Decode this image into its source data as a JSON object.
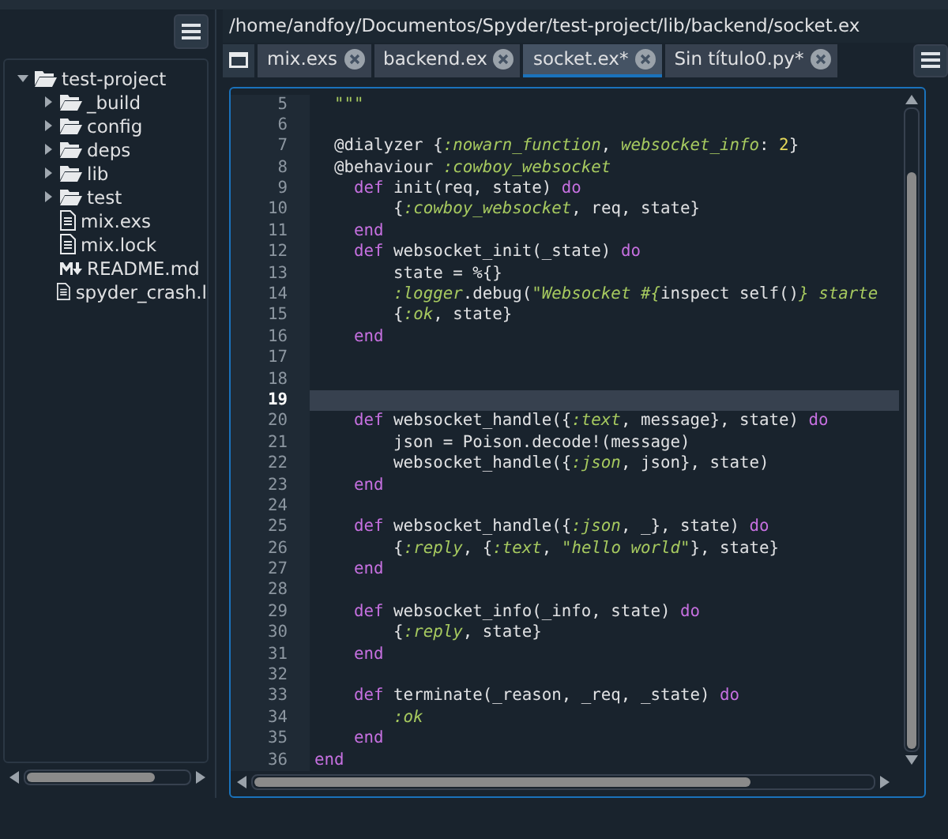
{
  "file_tree": {
    "items": [
      {
        "name": "test-project",
        "kind": "folder",
        "expanded": true,
        "children": [
          {
            "name": "_build",
            "kind": "folder",
            "expanded": false
          },
          {
            "name": "config",
            "kind": "folder",
            "expanded": false
          },
          {
            "name": "deps",
            "kind": "folder",
            "expanded": false
          },
          {
            "name": "lib",
            "kind": "folder",
            "expanded": false
          },
          {
            "name": "test",
            "kind": "folder",
            "expanded": false
          },
          {
            "name": "mix.exs",
            "kind": "file"
          },
          {
            "name": "mix.lock",
            "kind": "file"
          },
          {
            "name": "README.md",
            "kind": "markdown"
          },
          {
            "name": "spyder_crash.l",
            "kind": "file"
          }
        ]
      }
    ]
  },
  "editor": {
    "path": "/home/andfoy/Documentos/Spyder/test-project/lib/backend/socket.ex",
    "tabs": [
      {
        "label": "mix.exs",
        "selected": false
      },
      {
        "label": "backend.ex",
        "selected": false
      },
      {
        "label": "socket.ex*",
        "selected": true
      },
      {
        "label": "Sin título0.py*",
        "selected": false
      }
    ],
    "lines": [
      {
        "number": "5",
        "current": false,
        "tokens": [
          {
            "kind": "str",
            "text": "  \"\"\""
          }
        ]
      },
      {
        "number": "6",
        "current": false
      },
      {
        "number": "7",
        "current": false,
        "tokens": [
          {
            "kind": "plain",
            "text": "  @dialyzer {"
          },
          {
            "kind": "sym",
            "text": ":nowarn_function"
          },
          {
            "kind": "plain",
            "text": ", "
          },
          {
            "kind": "sym",
            "text": "websocket_info"
          },
          {
            "kind": "plain",
            "text": ": "
          },
          {
            "kind": "num",
            "text": "2"
          },
          {
            "kind": "plain",
            "text": "}"
          }
        ]
      },
      {
        "number": "8",
        "current": false,
        "tokens": [
          {
            "kind": "plain",
            "text": "  @behaviour "
          },
          {
            "kind": "sym",
            "text": ":cowboy_websocket"
          }
        ]
      },
      {
        "number": "9",
        "current": false,
        "tokens": [
          {
            "kind": "kw",
            "text": "    def"
          },
          {
            "kind": "plain",
            "text": " init(req, state) "
          },
          {
            "kind": "kw",
            "text": "do"
          }
        ]
      },
      {
        "number": "10",
        "current": false,
        "tokens": [
          {
            "kind": "plain",
            "text": "        {"
          },
          {
            "kind": "sym",
            "text": ":cowboy_websocket"
          },
          {
            "kind": "plain",
            "text": ", req, state}"
          }
        ]
      },
      {
        "number": "11",
        "current": false,
        "tokens": [
          {
            "kind": "kw",
            "text": "    end"
          }
        ]
      },
      {
        "number": "12",
        "current": false,
        "tokens": [
          {
            "kind": "kw",
            "text": "    def"
          },
          {
            "kind": "plain",
            "text": " websocket_init(_state) "
          },
          {
            "kind": "kw",
            "text": "do"
          }
        ]
      },
      {
        "number": "13",
        "current": false,
        "tokens": [
          {
            "kind": "plain",
            "text": "        state = %{}"
          }
        ]
      },
      {
        "number": "14",
        "current": false,
        "tokens": [
          {
            "kind": "sym",
            "text": "        :logger"
          },
          {
            "kind": "plain",
            "text": ".debug("
          },
          {
            "kind": "str",
            "text": "\"Websocket #{"
          },
          {
            "kind": "plain",
            "text": "inspect self()"
          },
          {
            "kind": "str",
            "text": "} starte"
          }
        ]
      },
      {
        "number": "15",
        "current": false,
        "tokens": [
          {
            "kind": "plain",
            "text": "        {"
          },
          {
            "kind": "sym",
            "text": ":ok"
          },
          {
            "kind": "plain",
            "text": ", state}"
          }
        ]
      },
      {
        "number": "16",
        "current": false,
        "tokens": [
          {
            "kind": "kw",
            "text": "    end"
          }
        ]
      },
      {
        "number": "17",
        "current": false
      },
      {
        "number": "18",
        "current": false
      },
      {
        "number": "19",
        "current": true
      },
      {
        "number": "20",
        "current": false,
        "tokens": [
          {
            "kind": "kw",
            "text": "    def"
          },
          {
            "kind": "plain",
            "text": " websocket_handle({"
          },
          {
            "kind": "sym",
            "text": ":text"
          },
          {
            "kind": "plain",
            "text": ", message}, state) "
          },
          {
            "kind": "kw",
            "text": "do"
          }
        ]
      },
      {
        "number": "21",
        "current": false,
        "tokens": [
          {
            "kind": "plain",
            "text": "        json = Poison.decode!(message)"
          }
        ]
      },
      {
        "number": "22",
        "current": false,
        "tokens": [
          {
            "kind": "plain",
            "text": "        websocket_handle({"
          },
          {
            "kind": "sym",
            "text": ":json"
          },
          {
            "kind": "plain",
            "text": ", json}, state)"
          }
        ]
      },
      {
        "number": "23",
        "current": false,
        "tokens": [
          {
            "kind": "kw",
            "text": "    end"
          }
        ]
      },
      {
        "number": "24",
        "current": false
      },
      {
        "number": "25",
        "current": false,
        "tokens": [
          {
            "kind": "kw",
            "text": "    def"
          },
          {
            "kind": "plain",
            "text": " websocket_handle({"
          },
          {
            "kind": "sym",
            "text": ":json"
          },
          {
            "kind": "plain",
            "text": ", _}, state) "
          },
          {
            "kind": "kw",
            "text": "do"
          }
        ]
      },
      {
        "number": "26",
        "current": false,
        "tokens": [
          {
            "kind": "plain",
            "text": "        {"
          },
          {
            "kind": "sym",
            "text": ":reply"
          },
          {
            "kind": "plain",
            "text": ", {"
          },
          {
            "kind": "sym",
            "text": ":text"
          },
          {
            "kind": "plain",
            "text": ", "
          },
          {
            "kind": "str",
            "text": "\"hello world\""
          },
          {
            "kind": "plain",
            "text": "}, state}"
          }
        ]
      },
      {
        "number": "27",
        "current": false,
        "tokens": [
          {
            "kind": "kw",
            "text": "    end"
          }
        ]
      },
      {
        "number": "28",
        "current": false
      },
      {
        "number": "29",
        "current": false,
        "tokens": [
          {
            "kind": "kw",
            "text": "    def"
          },
          {
            "kind": "plain",
            "text": " websocket_info(_info, state) "
          },
          {
            "kind": "kw",
            "text": "do"
          }
        ]
      },
      {
        "number": "30",
        "current": false,
        "tokens": [
          {
            "kind": "plain",
            "text": "        {"
          },
          {
            "kind": "sym",
            "text": ":reply"
          },
          {
            "kind": "plain",
            "text": ", state}"
          }
        ]
      },
      {
        "number": "31",
        "current": false,
        "tokens": [
          {
            "kind": "kw",
            "text": "    end"
          }
        ]
      },
      {
        "number": "32",
        "current": false
      },
      {
        "number": "33",
        "current": false,
        "tokens": [
          {
            "kind": "kw",
            "text": "    def"
          },
          {
            "kind": "plain",
            "text": " terminate(_reason, _req, _state) "
          },
          {
            "kind": "kw",
            "text": "do"
          }
        ]
      },
      {
        "number": "34",
        "current": false,
        "tokens": [
          {
            "kind": "sym",
            "text": "        :ok"
          }
        ]
      },
      {
        "number": "35",
        "current": false,
        "tokens": [
          {
            "kind": "kw",
            "text": "    end"
          }
        ]
      },
      {
        "number": "36",
        "current": false,
        "tokens": [
          {
            "kind": "kw",
            "text": "end"
          }
        ]
      }
    ]
  }
}
